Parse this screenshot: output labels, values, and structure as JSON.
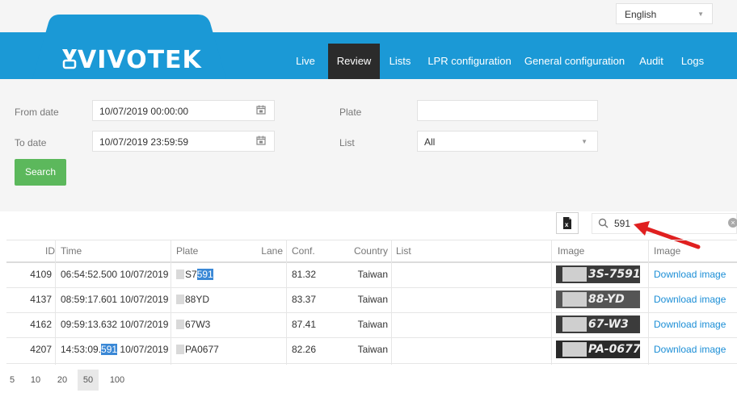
{
  "language": {
    "selected": "English"
  },
  "brand": {
    "name": "VIVOTEK"
  },
  "nav": {
    "items": [
      {
        "label": "Live"
      },
      {
        "label": "Review"
      },
      {
        "label": "Lists"
      },
      {
        "label": "LPR configuration"
      },
      {
        "label": "General configuration"
      },
      {
        "label": "Audit"
      },
      {
        "label": "Logs"
      }
    ],
    "active": "Review"
  },
  "form": {
    "from_date_label": "From date",
    "from_date_value": "10/07/2019 00:00:00",
    "to_date_label": "To date",
    "to_date_value": "10/07/2019 23:59:59",
    "plate_label": "Plate",
    "plate_value": "",
    "list_label": "List",
    "list_value": "All",
    "search_label": "Search"
  },
  "filter": {
    "value": "591",
    "icon": "search-icon"
  },
  "table": {
    "columns": [
      "ID",
      "Time",
      "Plate",
      "Lane",
      "Conf.",
      "Country",
      "List",
      "Image",
      "Image"
    ],
    "rows": [
      {
        "id": "4109",
        "time_a": "06:54:52.500 10/07/2019",
        "time_pre": "",
        "time_hl": "",
        "time_post": "",
        "plate_pre": "S7",
        "plate_hl": "591",
        "lane": "",
        "conf": "81.32",
        "country": "Taiwan",
        "list": "",
        "image_text": "3S-7591",
        "download": "Download image"
      },
      {
        "id": "4137",
        "time_a": "08:59:17.601 10/07/2019",
        "time_pre": "",
        "time_hl": "",
        "time_post": "",
        "plate_pre": "88YD",
        "plate_hl": "",
        "lane": "",
        "conf": "83.37",
        "country": "Taiwan",
        "list": "",
        "image_text": "88-YD",
        "download": "Download image"
      },
      {
        "id": "4162",
        "time_a": "09:59:13.632 10/07/2019",
        "time_pre": "",
        "time_hl": "",
        "time_post": "",
        "plate_pre": "67W3",
        "plate_hl": "",
        "lane": "",
        "conf": "87.41",
        "country": "Taiwan",
        "list": "",
        "image_text": "67-W3",
        "download": "Download image"
      },
      {
        "id": "4207",
        "time_a": "",
        "time_pre": "14:53:09.",
        "time_hl": "591",
        "time_post": " 10/07/2019",
        "plate_pre": "PA0677",
        "plate_hl": "",
        "lane": "",
        "conf": "82.26",
        "country": "Taiwan",
        "list": "",
        "image_text": "PA-0677",
        "download": "Download image"
      }
    ]
  },
  "pagination": {
    "sizes": [
      "5",
      "10",
      "20",
      "50",
      "100"
    ],
    "selected": "50"
  },
  "colors": {
    "header": "#1b99d6",
    "active_nav": "#2b2b2b",
    "search_button": "#5cb85c",
    "highlight": "#3a88d6",
    "link": "#1b8ed6",
    "annotation_arrow": "#e02020"
  }
}
